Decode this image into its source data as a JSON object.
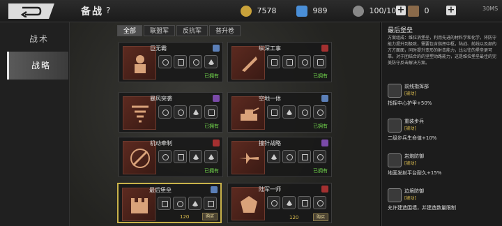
{
  "header": {
    "title": "备战",
    "help": "?",
    "gold": "7578",
    "gems": "989",
    "stamina": "100/100",
    "tickets": "0",
    "net": "30MS"
  },
  "sidebar": {
    "items": [
      {
        "label": "战术"
      },
      {
        "label": "战略"
      }
    ]
  },
  "tabs": [
    "全部",
    "联盟军",
    "反抗军",
    "普升卷"
  ],
  "cards": [
    {
      "name": "巨无霸",
      "status": "已拥有"
    },
    {
      "name": "纵深工事",
      "status": "已拥有"
    },
    {
      "name": "暴风突袭",
      "status": "已拥有"
    },
    {
      "name": "空地一体",
      "status": "已拥有"
    },
    {
      "name": "机动牵制",
      "status": "已拥有"
    },
    {
      "name": "撞针战略",
      "status": "已拥有"
    },
    {
      "name": "最后堡垒",
      "cost": "120",
      "buy": "购买"
    },
    {
      "name": "陆军一师",
      "cost": "120",
      "buy": "购买"
    }
  ],
  "detail": {
    "title": "最后堡垒",
    "description": "方案组成：维拉消堡垒，利用先进的材料学和化学，将防守能力提升到极致，需要包含指挥中枢，陆战、前线以及部的方方面面，同时提升变形的射击能力，比以往的堡垒更可靠。对于团结合的的坚塑动路能力，这是维拉堡垒最佳的完美防守反击解决方案。",
    "effects": [
      {
        "name": "前线指挥部",
        "state": "[被动]",
        "value": "指挥中心护甲+50%"
      },
      {
        "name": "重装步兵",
        "state": "[被动]",
        "value": "二级步兵生命值+10%"
      },
      {
        "name": "岩炮防御",
        "state": "[被动]",
        "value": "地面发射平台耐久+15%"
      },
      {
        "name": "边境防御",
        "state": "[被动]",
        "value": "允许建造围墙，并建造数量限制"
      }
    ]
  },
  "colors": {
    "owned": "#6fd24a",
    "gold": "#e0c050",
    "selected": "#c9b24a"
  }
}
